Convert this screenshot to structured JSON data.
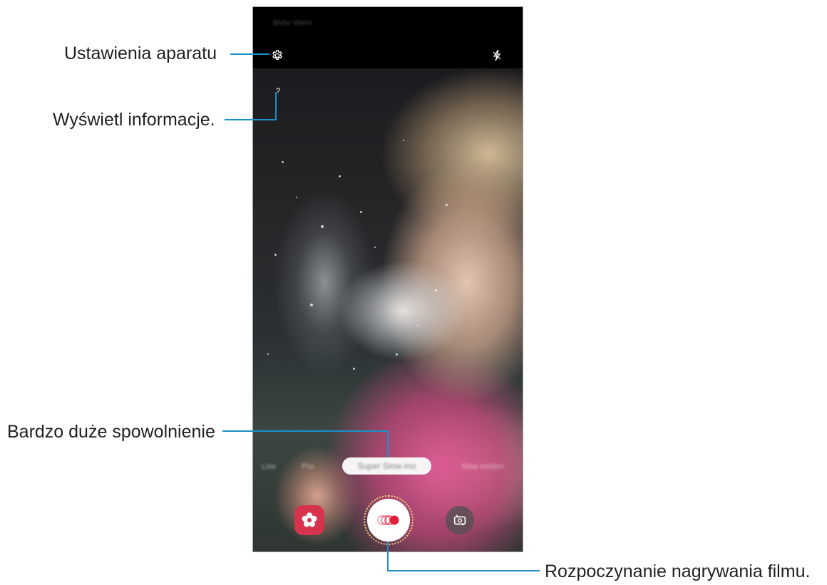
{
  "phone": {
    "status_text": "Bixby Vision",
    "help_glyph": "?"
  },
  "callouts": {
    "settings": "Ustawienia aparatu",
    "info": "Wyświetl informacje.",
    "super_slow": "Bardzo duże spowolnienie",
    "record": "Rozpoczynanie nagrywania filmu."
  },
  "modes": {
    "items": [
      "Live",
      "Pro",
      "Super Slow-mo",
      "Slow motion"
    ],
    "selected": "Super Slow-mo"
  },
  "icons": {
    "settings": "gear-icon",
    "flash": "flash-off-icon",
    "help": "question-mark-icon",
    "effect": "flower-effect-icon",
    "record": "super-slow-record-icon",
    "switch_camera": "switch-camera-icon"
  },
  "colors": {
    "leader_line": "#1a8fc8",
    "effect_button": "#d8334e",
    "record_dot": "#e0203a"
  }
}
